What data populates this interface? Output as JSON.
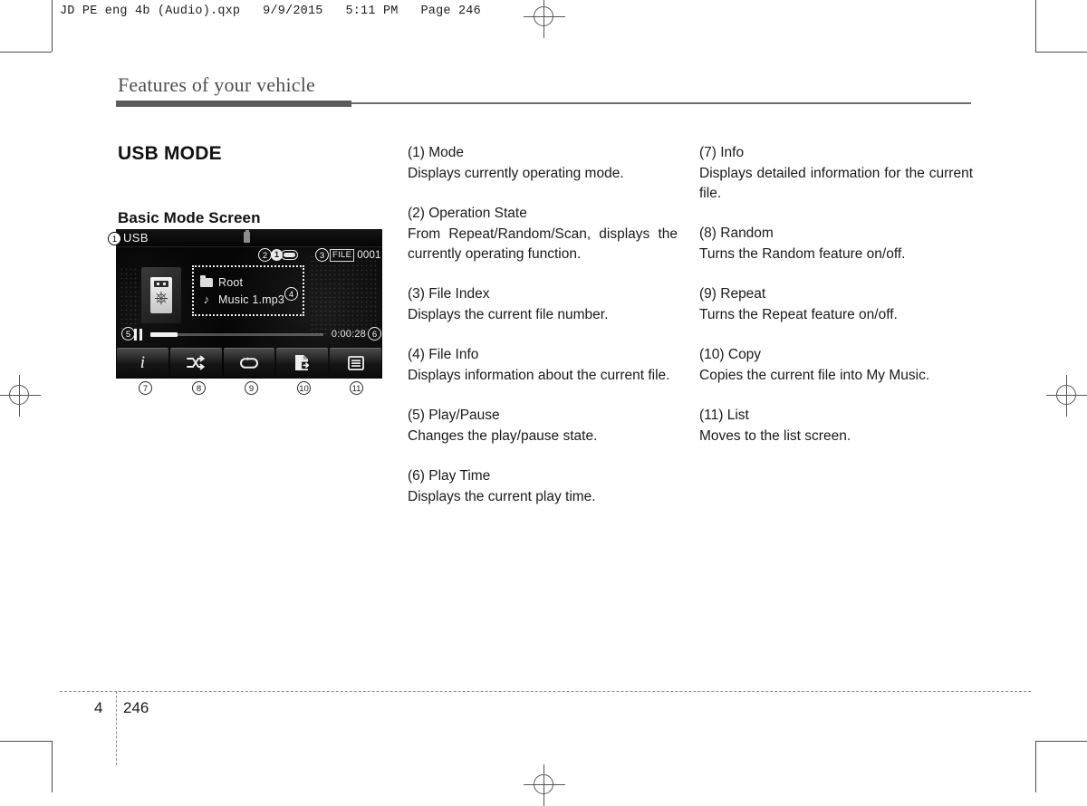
{
  "print_header": "JD PE eng 4b (Audio).qxp   9/9/2015   5:11 PM   Page 246",
  "page": {
    "running_title": "Features of your vehicle",
    "chapter_number": "4",
    "page_number": "246"
  },
  "section": {
    "heading": "USB MODE",
    "subheading": "Basic Mode Screen"
  },
  "device_screen": {
    "mode_label": "USB",
    "usb_chip_icon": "usb-device-icon",
    "operation_state": {
      "repeat_one_icon": "repeat-one-icon",
      "badge_number": "1"
    },
    "file_index": {
      "label": "FILE",
      "value": "0001"
    },
    "album_art_icon": "usb-drive-icon",
    "file_info": {
      "folder": "Root",
      "folder_icon": "folder-icon",
      "track": "Music 1.mp3",
      "track_icon": "music-note-icon"
    },
    "transport": {
      "state_icon": "pause-icon",
      "progress_percent": 16,
      "play_time": "0:00:28"
    },
    "buttons": [
      {
        "id": "info",
        "icon": "info-icon",
        "callout": "7"
      },
      {
        "id": "random",
        "icon": "shuffle-icon",
        "callout": "8"
      },
      {
        "id": "repeat",
        "icon": "repeat-icon",
        "callout": "9"
      },
      {
        "id": "copy",
        "icon": "copy-icon",
        "callout": "10"
      },
      {
        "id": "list",
        "icon": "list-icon",
        "callout": "11"
      }
    ],
    "callouts": {
      "mode": "1",
      "operation_state": "2",
      "file_index": "3",
      "file_info": "4",
      "play_pause": "5",
      "play_time": "6"
    }
  },
  "descriptions": {
    "middle": [
      {
        "title": "(1) Mode",
        "desc": "Displays currently operating mode."
      },
      {
        "title": "(2) Operation State",
        "desc": "From Repeat/Random/Scan, displays the currently operating function."
      },
      {
        "title": "(3) File Index",
        "desc": "Displays the current file number."
      },
      {
        "title": "(4) File Info",
        "desc": "Displays information about the current file."
      },
      {
        "title": "(5) Play/Pause",
        "desc": "Changes the play/pause state."
      },
      {
        "title": "(6) Play Time",
        "desc": "Displays the current play time."
      }
    ],
    "right": [
      {
        "title": "(7) Info",
        "desc": "Displays detailed information for the current file."
      },
      {
        "title": "(8) Random",
        "desc": "Turns the Random feature on/off."
      },
      {
        "title": "(9) Repeat",
        "desc": "Turns the Repeat feature on/off."
      },
      {
        "title": "(10) Copy",
        "desc": "Copies the current file into My Music."
      },
      {
        "title": "(11) List",
        "desc": "Moves to the list screen."
      }
    ]
  }
}
